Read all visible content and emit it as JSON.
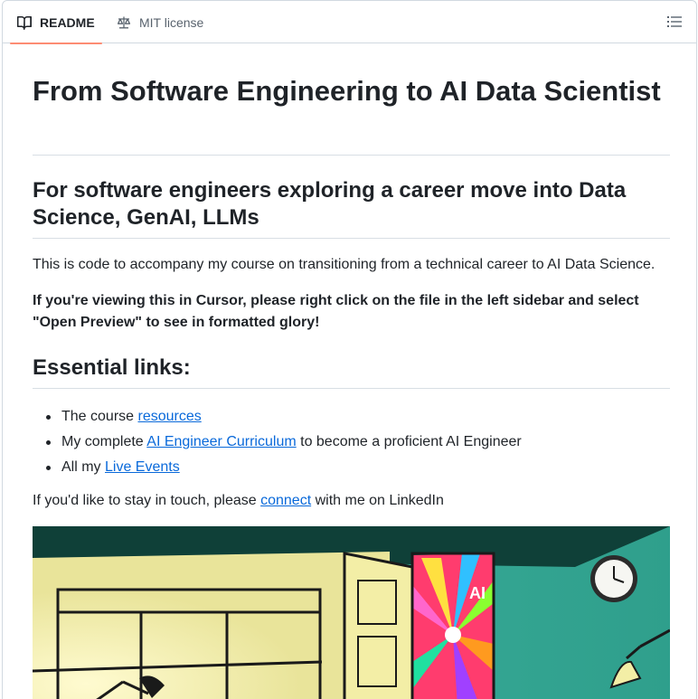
{
  "tabs": {
    "readme_label": "README",
    "license_label": "MIT license"
  },
  "icons": {
    "readme": "book-icon",
    "license": "scale-icon",
    "outline": "list-unordered-icon"
  },
  "colors": {
    "link": "#0969da",
    "active_tab_underline": "#fd8c73",
    "text": "#1f2328"
  },
  "readme": {
    "title": "From Software Engineering to AI Data Scientist",
    "subtitle": "For software engineers exploring a career move into Data Science, GenAI, LLMs",
    "intro": "This is code to accompany my course on transitioning from a technical career to AI Data Science.",
    "cursor_note": "If you're viewing this in Cursor, please right click on the file in the left sidebar and select \"Open Preview\" to see in formatted glory!",
    "links_heading": "Essential links:",
    "links": [
      {
        "before": "The course ",
        "link": "resources",
        "after": ""
      },
      {
        "before": "My complete ",
        "link": "AI Engineer Curriculum",
        "after": " to become a proficient AI Engineer"
      },
      {
        "before": "All my ",
        "link": "Live Events",
        "after": ""
      }
    ],
    "contact": {
      "before": "If you'd like to stay in touch, please ",
      "link": "connect",
      "after": " with me on LinkedIn"
    },
    "image_text": "AI"
  }
}
